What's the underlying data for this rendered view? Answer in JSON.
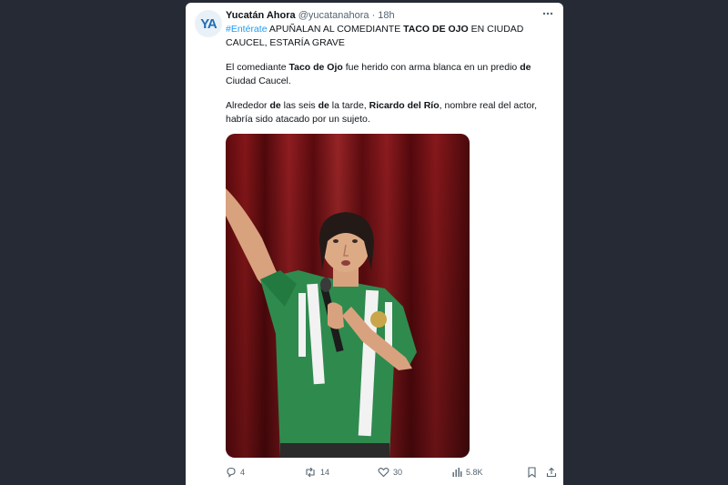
{
  "tweet": {
    "avatar_text": "YA",
    "author_name": "Yucatán Ahora",
    "author_meta": "@yucatanahora · 18h",
    "line1": {
      "hashtag": "#Entérate",
      "part1": " APUÑALAN AL COMEDIANTE ",
      "bold": "TACO DE OJO",
      "part2": " EN CIUDAD"
    },
    "line2": "CAUCEL, ESTARÍA GRAVE",
    "para2": {
      "a": "El comediante ",
      "b_bold": "Taco de Ojo",
      "c": " fue herido con arma blanca en un predio ",
      "d_bold": "de",
      "line2": "Ciudad Caucel."
    },
    "para3": {
      "a": "Alrededor ",
      "b_bold": "de",
      "c": " las seis ",
      "d_bold": "de",
      "e": " la tarde, ",
      "f_bold": "Ricardo del Río",
      "g": ", nombre real del actor,",
      "line2": "habría sido atacado por un sujeto."
    }
  },
  "actions": {
    "replies": "4",
    "retweets": "14",
    "likes": "30",
    "views": "5.8K"
  },
  "icons": {
    "more": "more-icon",
    "reply": "reply-icon",
    "retweet": "retweet-icon",
    "like": "heart-icon",
    "views": "views-icon",
    "bookmark": "bookmark-icon",
    "share": "share-icon"
  },
  "colors": {
    "background": "#252a34",
    "hashtag": "#1d9bf0",
    "avatar_text": "#1f6eb5"
  }
}
